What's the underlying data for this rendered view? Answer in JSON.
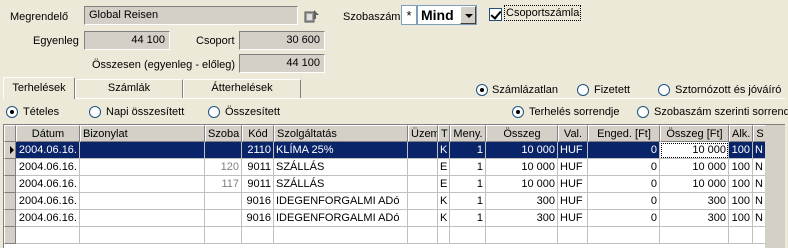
{
  "header": {
    "megrendelo_label": "Megrendelő",
    "megrendelo_value": "Global Reisen",
    "szobaszam_label": "Szobaszám",
    "szobaszam_star": "*",
    "szobaszam_value": "Mind",
    "csoportszamla_label": "Csoportszámla",
    "csoportszamla_checked": true,
    "egyenleg_label": "Egyenleg",
    "egyenleg_value": "44 100",
    "csoport_label": "Csoport",
    "csoport_value": "30 600",
    "osszesen_label": "Összesen (egyenleg - előleg)",
    "osszesen_value": "44 100"
  },
  "tabs": [
    {
      "label": "Terhelések",
      "active": true
    },
    {
      "label": "Számlák",
      "active": false
    },
    {
      "label": "Átterhelések",
      "active": false
    }
  ],
  "status_filter": {
    "options": [
      "Számlázatlan",
      "Fizetett",
      "Sztornózott és jóváíró"
    ],
    "selected": "Számlázatlan"
  },
  "mode_filter": {
    "options": [
      "Tételes",
      "Napi összesített",
      "Összesített"
    ],
    "selected": "Tételes"
  },
  "sort_filter": {
    "options": [
      "Terhelés sorrendje",
      "Szobaszám szerinti sorrend"
    ],
    "selected": "Terhelés sorrendje"
  },
  "grid": {
    "columns": [
      "Dátum",
      "Bizonylat",
      "Szoba",
      "Kód",
      "Szolgáltatás",
      "Üzem",
      "T",
      "Meny.",
      "Összeg",
      "Val.",
      "Enged. [Ft]",
      "Összeg [Ft]",
      "Alk.",
      "S"
    ],
    "rows": [
      {
        "datum": "2004.06.16.",
        "bizonylat": "",
        "szoba": "",
        "kod": "2110",
        "szolg": "KLÍMA 25%",
        "uzem": "",
        "t": "K",
        "meny": "1",
        "osszeg": "10 000",
        "val": "HUF",
        "enged": "0",
        "osszeg_ft": "10 000",
        "alk": "100",
        "s": "N",
        "selected": true
      },
      {
        "datum": "2004.06.16.",
        "bizonylat": "",
        "szoba": "120",
        "kod": "9011",
        "szolg": "SZÁLLÁS",
        "uzem": "",
        "t": "E",
        "meny": "1",
        "osszeg": "10 000",
        "val": "HUF",
        "enged": "0",
        "osszeg_ft": "10 000",
        "alk": "100",
        "s": "N",
        "selected": false
      },
      {
        "datum": "2004.06.16.",
        "bizonylat": "",
        "szoba": "117",
        "kod": "9011",
        "szolg": "SZÁLLÁS",
        "uzem": "",
        "t": "E",
        "meny": "1",
        "osszeg": "10 000",
        "val": "HUF",
        "enged": "0",
        "osszeg_ft": "10 000",
        "alk": "100",
        "s": "N",
        "selected": false
      },
      {
        "datum": "2004.06.16.",
        "bizonylat": "",
        "szoba": "",
        "kod": "9016",
        "szolg": "IDEGENFORGALMI ADó",
        "uzem": "",
        "t": "K",
        "meny": "1",
        "osszeg": "300",
        "val": "HUF",
        "enged": "0",
        "osszeg_ft": "300",
        "alk": "100",
        "s": "N",
        "selected": false
      },
      {
        "datum": "2004.06.16.",
        "bizonylat": "",
        "szoba": "",
        "kod": "9016",
        "szolg": "IDEGENFORGALMI ADó",
        "uzem": "",
        "t": "K",
        "meny": "1",
        "osszeg": "300",
        "val": "HUF",
        "enged": "0",
        "osszeg_ft": "300",
        "alk": "100",
        "s": "N",
        "selected": false
      },
      {
        "datum": "",
        "bizonylat": "",
        "szoba": "",
        "kod": "",
        "szolg": "",
        "uzem": "",
        "t": "",
        "meny": "",
        "osszeg": "",
        "val": "",
        "enged": "",
        "osszeg_ft": "",
        "alk": "",
        "s": "",
        "selected": false
      }
    ]
  },
  "colors": {
    "window_bg": "#ECE9D8",
    "selection": "#0A246A"
  }
}
